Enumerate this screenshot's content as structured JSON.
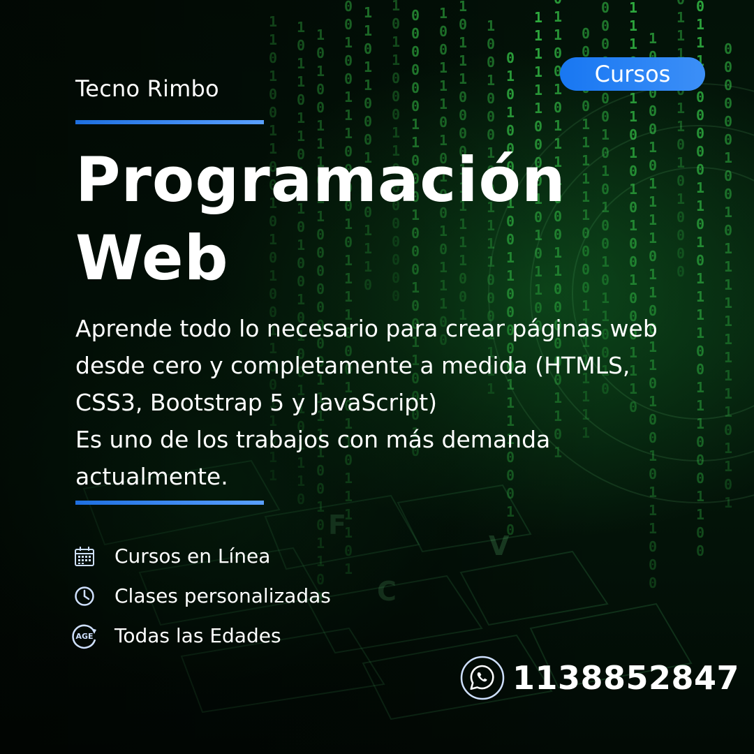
{
  "brand": "Tecno Rimbo",
  "badge": "Cursos",
  "title": {
    "line1": "Programación",
    "line2": "Web"
  },
  "description": {
    "lines": [
      "Aprende todo lo necesario para crear páginas web",
      "desde cero y completamente a medida (HTMLS,",
      "CSS3, Bootstrap 5 y JavaScript)",
      "Es uno de los trabajos con más demanda",
      "actualmente."
    ]
  },
  "features": [
    {
      "icon": "calendar-icon",
      "label": "Cursos en Línea"
    },
    {
      "icon": "clock-icon",
      "label": "Clases personalizadas"
    },
    {
      "icon": "age-icon",
      "label": "Todas las Edades",
      "icon_text": "AGE"
    }
  ],
  "contact": {
    "icon": "whatsapp-icon",
    "phone": "1138852847"
  },
  "colors": {
    "accent": "#1877f2",
    "matrix_green": "#3cdc50",
    "icon_light": "#cfe0ff"
  }
}
